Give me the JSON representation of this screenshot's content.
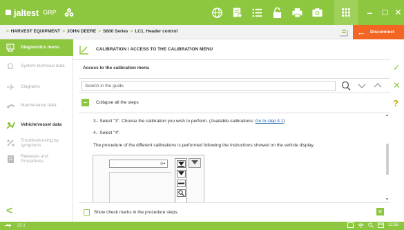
{
  "app": {
    "logo_text": "jaltest",
    "logo_product": "GRP"
  },
  "colors": {
    "brand_green": "#8dc63f",
    "accent_orange": "#f26522",
    "link_blue": "#1a5ea8"
  },
  "toolbar": {
    "icons": [
      "globe-icon",
      "report-icon",
      "list-icon",
      "lock-icon",
      "print-icon",
      "camera-icon",
      "help-icon",
      "grid-icon"
    ],
    "help_glyph": "?",
    "minimize": "–",
    "maximize": "☐",
    "close": "✕"
  },
  "breadcrumb": {
    "items": [
      "HARVEST EQUIPMENT",
      "JOHN DEERE",
      "S600 Series",
      "LC1, Header control"
    ],
    "separator": ">"
  },
  "disconnect": {
    "label": "Disconnect"
  },
  "sidebar": {
    "items": [
      {
        "label": "Diagnostics menu"
      },
      {
        "label": "System technical data"
      },
      {
        "label": "Diagrams"
      },
      {
        "label": "Maintenance data"
      },
      {
        "label": "Vehicle/vessel data"
      },
      {
        "label": "Troubleshooting by symptoms"
      },
      {
        "label": "Releases and Procedures"
      }
    ],
    "back_glyph": "<"
  },
  "content": {
    "header_title": "CALIBRATION \\ ACCESS TO THE CALIBRATION MENU",
    "section_title": "Access to the calibration menu",
    "search_placeholder": "Search in the guide",
    "collapse_label": "Collapse all the steps",
    "step3_text": "3.- Select \"3\".  Choose the calibration you wish to perform.  (Available calibrations: ",
    "step3_link": "Go to step 4.1",
    "step3_end": ")",
    "step4_text": "4.- Select \"4\".",
    "procedure_text": "The procedure of the different calibrations is performed following the instructions showed on the vehicle display.",
    "check_marks_label": "Show check marks in the procedure steps.",
    "bottom_close": "✕"
  },
  "right_actions": {
    "accept": "✓",
    "cancel": "✕",
    "help": "?"
  },
  "status": {
    "version": "22.1",
    "time": "12:58"
  }
}
